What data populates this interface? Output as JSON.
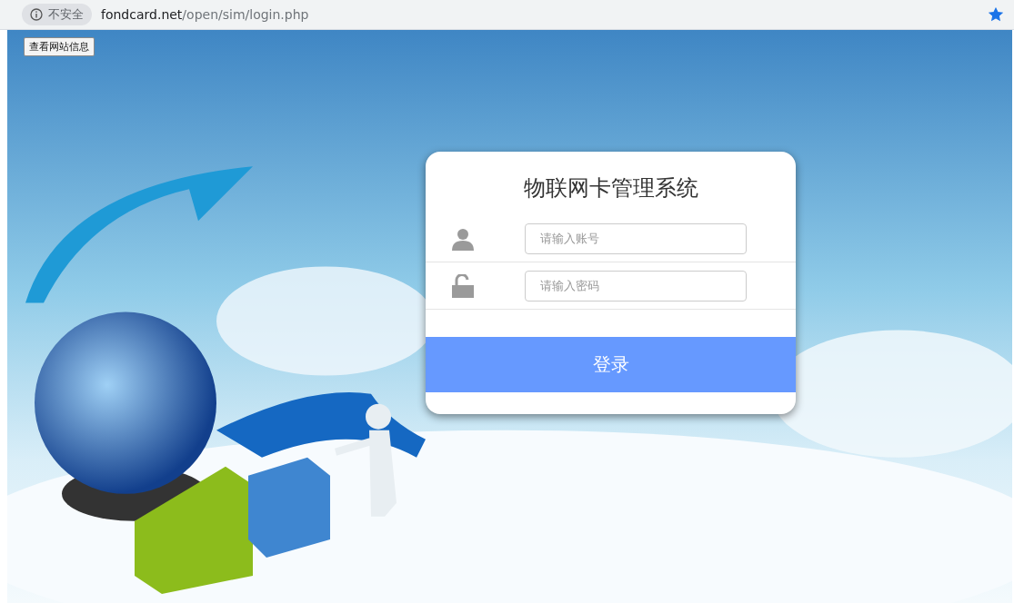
{
  "address_bar": {
    "security_label": "不安全",
    "url_host": "fondcard.net",
    "url_path": "/open/sim/login.php",
    "bookmarked": true
  },
  "site_info_button": "查看网站信息",
  "login_card": {
    "title": "物联网卡管理系统",
    "fields": [
      {
        "kind": "user",
        "placeholder": "请输入账号"
      },
      {
        "kind": "password",
        "placeholder": "请输入密码"
      }
    ],
    "submit_button": "登录"
  }
}
